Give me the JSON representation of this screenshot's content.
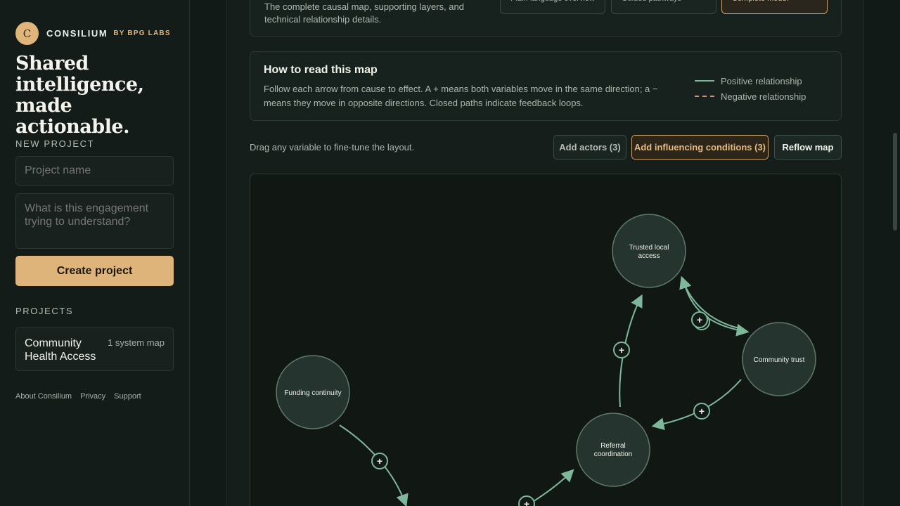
{
  "brand": {
    "logo_letter": "C",
    "name": "CONSILIUM",
    "sub": "BY BPG LABS",
    "tagline": "Shared intelligence, made actionable."
  },
  "new_project": {
    "label": "NEW PROJECT",
    "name_placeholder": "Project name",
    "question_placeholder": "What is this engagement trying to understand?",
    "create_label": "Create project"
  },
  "projects": {
    "label": "PROJECTS",
    "items": [
      {
        "name": "Community Health Access",
        "count": "1 system map"
      }
    ]
  },
  "footer": {
    "about": "About Consilium",
    "privacy": "Privacy",
    "support": "Support"
  },
  "view_panel": {
    "description": "The complete causal map, supporting layers, and technical relationship details.",
    "views": [
      "Plain-language overview",
      "Guided pathways",
      "Complete model"
    ],
    "active_view": "Complete model"
  },
  "howto": {
    "title": "How to read this map",
    "text": "Follow each arrow from cause to effect. A + means both variables move in the same direction; a − means they move in opposite directions. Closed paths indicate feedback loops.",
    "legend_positive": "Positive relationship",
    "legend_negative": "Negative relationship"
  },
  "toolbar": {
    "hint": "Drag any variable to fine-tune the layout.",
    "add_actors": "Add actors (3)",
    "add_conditions": "Add influencing conditions (3)",
    "reflow": "Reflow map"
  },
  "map": {
    "nodes": [
      {
        "id": "trusted",
        "lines": [
          "Trusted local",
          "access"
        ]
      },
      {
        "id": "community",
        "lines": [
          "Community trust"
        ]
      },
      {
        "id": "funding",
        "lines": [
          "Funding continuity"
        ]
      },
      {
        "id": "referral",
        "lines": [
          "Referral",
          "coordination"
        ]
      }
    ],
    "polarity_sign": "+"
  },
  "colors": {
    "accent": "#dfb47a",
    "positive": "#7fb79a",
    "negative": "#d7907a",
    "node_fill": "#26342f"
  }
}
